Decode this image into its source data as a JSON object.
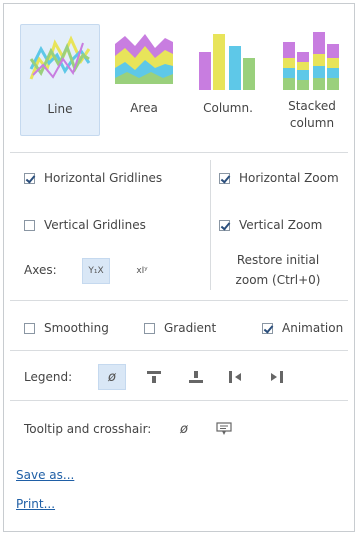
{
  "chart_types": [
    {
      "label": "Line",
      "selected": true,
      "icon": "line-chart-icon"
    },
    {
      "label": "Area",
      "selected": false,
      "icon": "area-chart-icon"
    },
    {
      "label": "Column.",
      "selected": false,
      "icon": "column-chart-icon"
    },
    {
      "label": "Stacked column",
      "selected": false,
      "icon": "stacked-column-chart-icon"
    }
  ],
  "gridlines": {
    "horizontal": {
      "label": "Horizontal Gridlines",
      "checked": true
    },
    "vertical": {
      "label": "Vertical Gridlines",
      "checked": false
    }
  },
  "zoom": {
    "horizontal": {
      "label": "Horizontal Zoom",
      "checked": true
    },
    "vertical": {
      "label": "Vertical Zoom",
      "checked": true
    },
    "restore_label": "Restore initial zoom (Ctrl+0)"
  },
  "axes": {
    "label": "Axes:",
    "buttons": [
      {
        "icon": "swap-axes-icon",
        "text": "Y₁X",
        "selected": true
      },
      {
        "icon": "axes-xy-icon",
        "text": "xIʸ",
        "selected": false
      }
    ]
  },
  "options": {
    "smoothing": {
      "label": "Smoothing",
      "checked": false
    },
    "gradient": {
      "label": "Gradient",
      "checked": false
    },
    "animation": {
      "label": "Animation",
      "checked": true
    }
  },
  "legend": {
    "label": "Legend:",
    "buttons": [
      {
        "icon": "no-legend-icon",
        "glyph": "ø",
        "selected": true
      },
      {
        "icon": "legend-top-icon",
        "glyph": "",
        "selected": false
      },
      {
        "icon": "legend-bottom-icon",
        "glyph": "",
        "selected": false
      },
      {
        "icon": "legend-left-icon",
        "glyph": "",
        "selected": false
      },
      {
        "icon": "legend-right-icon",
        "glyph": "",
        "selected": false
      }
    ]
  },
  "tooltip": {
    "label": "Tooltip and crosshair:",
    "buttons": [
      {
        "icon": "no-tooltip-icon",
        "glyph": "ø"
      },
      {
        "icon": "tooltip-icon",
        "glyph": ""
      }
    ]
  },
  "links": {
    "save": "Save as...",
    "print": "Print..."
  },
  "colors": {
    "selected_bg": "#e3eefa",
    "link": "#1f5fa6",
    "yellow": "#e8e45a",
    "cyan": "#5ec8e8",
    "purple": "#c87de0",
    "green": "#9ad07c"
  }
}
